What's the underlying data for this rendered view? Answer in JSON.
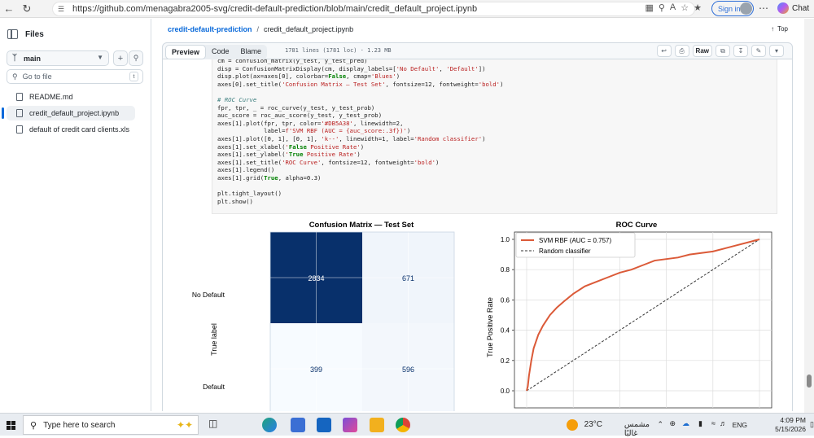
{
  "browser": {
    "url": "https://github.com/menagabra2005-svg/credit-default-prediction/blob/main/credit_default_project.ipynb",
    "signin_label": "Sign in",
    "chat_label": "Chat"
  },
  "sidebar": {
    "title": "Files",
    "branch": "main",
    "goto_placeholder": "Go to file",
    "goto_shortcut": "t",
    "files": [
      {
        "name": "README.md",
        "active": false
      },
      {
        "name": "credit_default_project.ipynb",
        "active": true
      },
      {
        "name": "default of credit card clients.xls",
        "active": false
      }
    ]
  },
  "header": {
    "repo": "credit-default-prediction",
    "separator": "/",
    "file": "credit_default_project.ipynb",
    "top_label": "Top"
  },
  "toolbar": {
    "tabs": [
      "Preview",
      "Code",
      "Blame"
    ],
    "active_tab": "Preview",
    "meta": "1781 lines (1781 loc) · 1.23 MB",
    "raw_label": "Raw"
  },
  "code_lines": [
    "cm = confusion_matrix(y_test, y_test_pred)",
    "disp = ConfusionMatrixDisplay(cm, display_labels=['No Default', 'Default'])",
    "disp.plot(ax=axes[0], colorbar=False, cmap='Blues')",
    "axes[0].set_title('Confusion Matrix — Test Set', fontsize=12, fontweight='bold')",
    "",
    "# ROC Curve",
    "fpr, tpr, _ = roc_curve(y_test, y_test_prob)",
    "auc_score = roc_auc_score(y_test, y_test_prob)",
    "axes[1].plot(fpr, tpr, color='#DB5A38', linewidth=2,",
    "             label=f'SVM RBF (AUC = {auc_score:.3f})')",
    "axes[1].plot([0, 1], [0, 1], 'k--', linewidth=1, label='Random classifier')",
    "axes[1].set_xlabel('False Positive Rate')",
    "axes[1].set_ylabel('True Positive Rate')",
    "axes[1].set_title('ROC Curve', fontsize=12, fontweight='bold')",
    "axes[1].legend()",
    "axes[1].grid(True, alpha=0.3)",
    "",
    "plt.tight_layout()",
    "plt.show()"
  ],
  "chart_data": [
    {
      "type": "heatmap",
      "title": "Confusion Matrix — Test Set",
      "ylabel": "True label",
      "row_labels": [
        "No Default",
        "Default"
      ],
      "values": [
        [
          2834,
          671
        ],
        [
          399,
          596
        ]
      ],
      "value_labels": [
        "2834",
        "671",
        "399",
        "596"
      ],
      "colormap": "Blues",
      "colors": {
        "high": "#08306b",
        "low": "#f7fbff",
        "mid_light": "#e3eef8"
      }
    },
    {
      "type": "line",
      "title": "ROC Curve",
      "ylabel": "True Positive Rate",
      "ylim": [
        0,
        1
      ],
      "yticks": [
        "0.0",
        "0.2",
        "0.4",
        "0.6",
        "0.8",
        "1.0"
      ],
      "grid": true,
      "legend_position": "top-left",
      "series": [
        {
          "name": "SVM RBF (AUC = 0.757)",
          "color": "#DB5A38",
          "x": [
            0,
            0.005,
            0.01,
            0.02,
            0.03,
            0.05,
            0.07,
            0.1,
            0.13,
            0.16,
            0.2,
            0.25,
            0.3,
            0.35,
            0.4,
            0.45,
            0.5,
            0.55,
            0.6,
            0.65,
            0.7,
            0.75,
            0.8,
            0.85,
            0.9,
            0.95,
            1.0
          ],
          "y": [
            0,
            0.03,
            0.1,
            0.2,
            0.28,
            0.37,
            0.43,
            0.5,
            0.55,
            0.59,
            0.64,
            0.69,
            0.72,
            0.75,
            0.78,
            0.8,
            0.83,
            0.86,
            0.87,
            0.88,
            0.9,
            0.91,
            0.92,
            0.94,
            0.96,
            0.98,
            1.0
          ]
        },
        {
          "name": "Random classifier",
          "color": "#333333",
          "x": [
            0,
            1
          ],
          "y": [
            0,
            1
          ]
        }
      ]
    }
  ],
  "taskbar": {
    "search_placeholder": "Type here to search",
    "weather": "23°C",
    "weather_desc": "مشمس غالبًا",
    "lang": "ENG",
    "time": "4:09 PM",
    "date": "5/15/2026"
  }
}
